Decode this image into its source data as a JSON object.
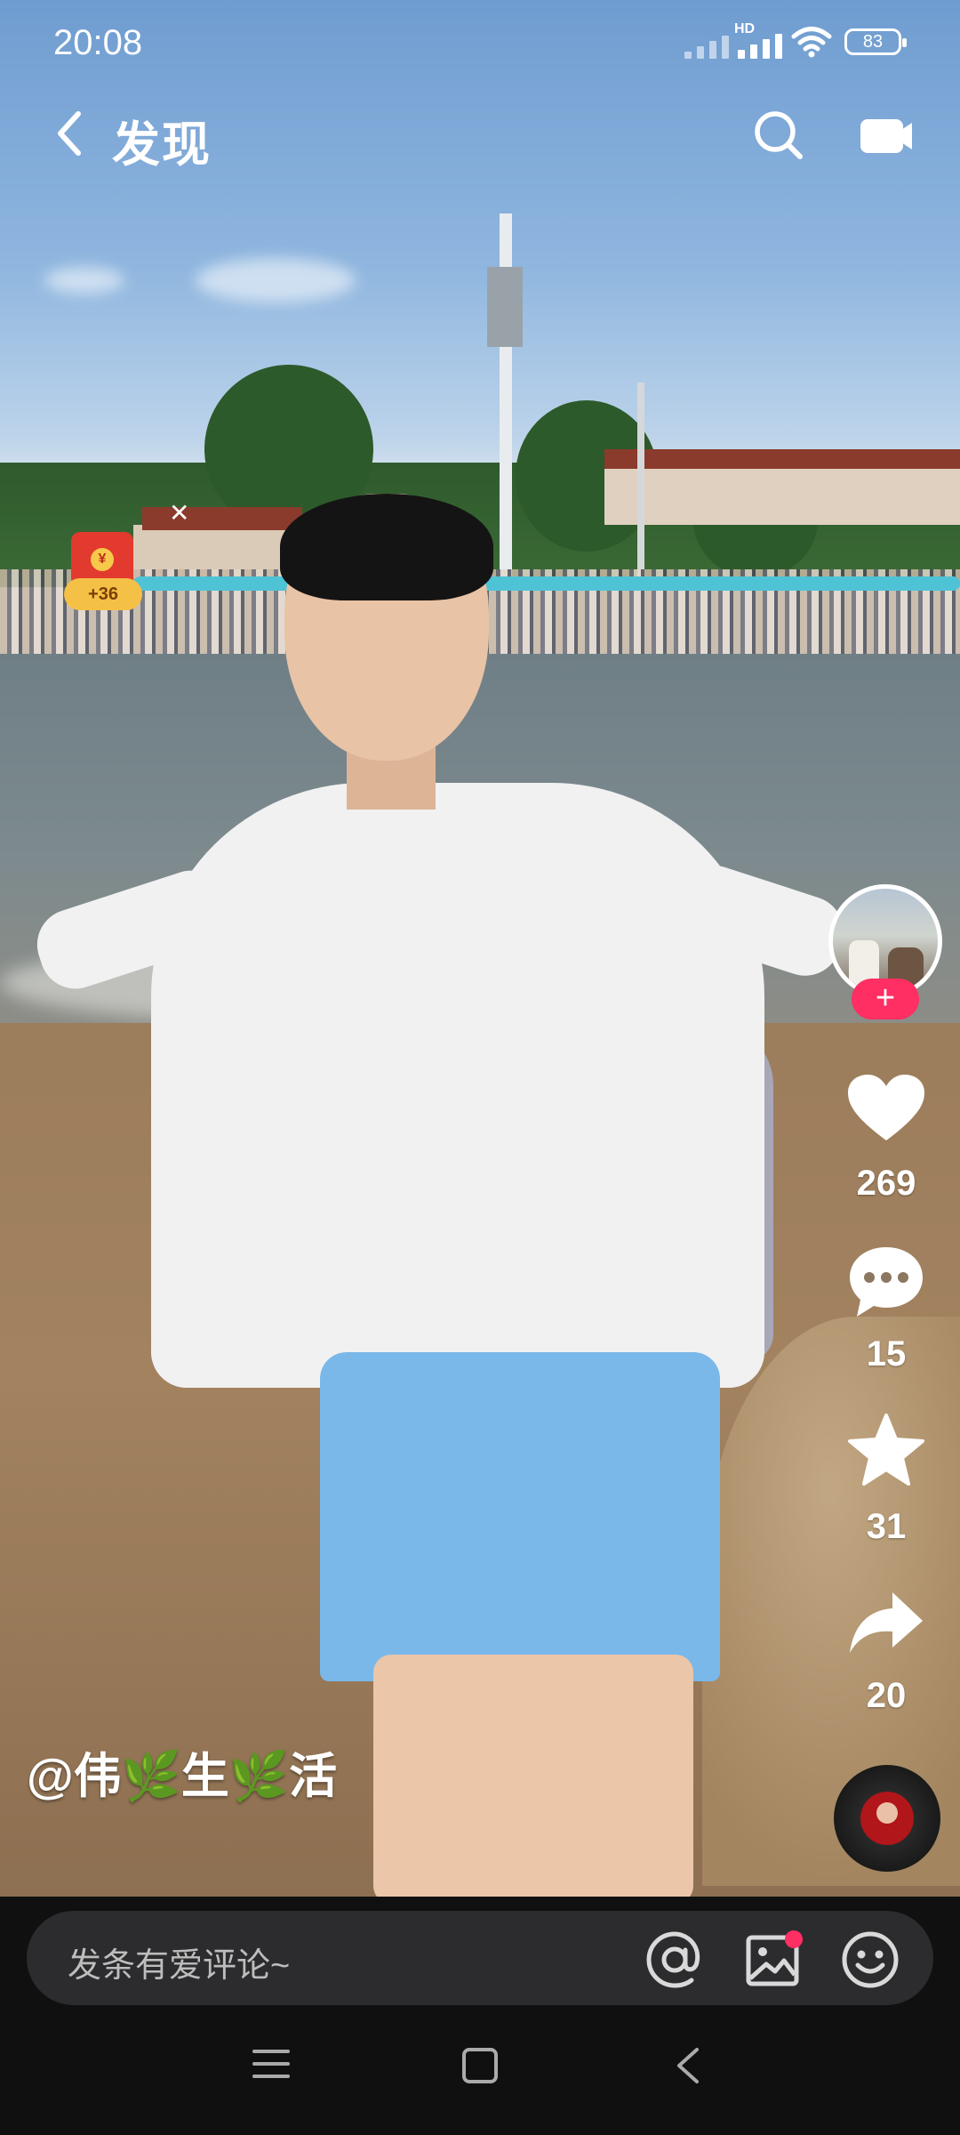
{
  "status_bar": {
    "time": "20:08",
    "network": "HD",
    "battery": "83"
  },
  "header": {
    "title": "发现",
    "back_icon": "back-arrow-icon",
    "search_icon": "search-icon",
    "camera_icon": "camera-icon"
  },
  "red_packet": {
    "badge": "+36",
    "coin": "¥"
  },
  "actions": {
    "likes": "269",
    "comments": "15",
    "favorites": "31",
    "shares": "20",
    "follow": "+"
  },
  "video": {
    "author_handle": "@伟🌿生🌿活"
  },
  "comment_bar": {
    "placeholder": "发条有爱评论~"
  },
  "colors": {
    "accent": "#ff2e63",
    "background": "#101010",
    "comment_bar": "#2c2c2e"
  }
}
